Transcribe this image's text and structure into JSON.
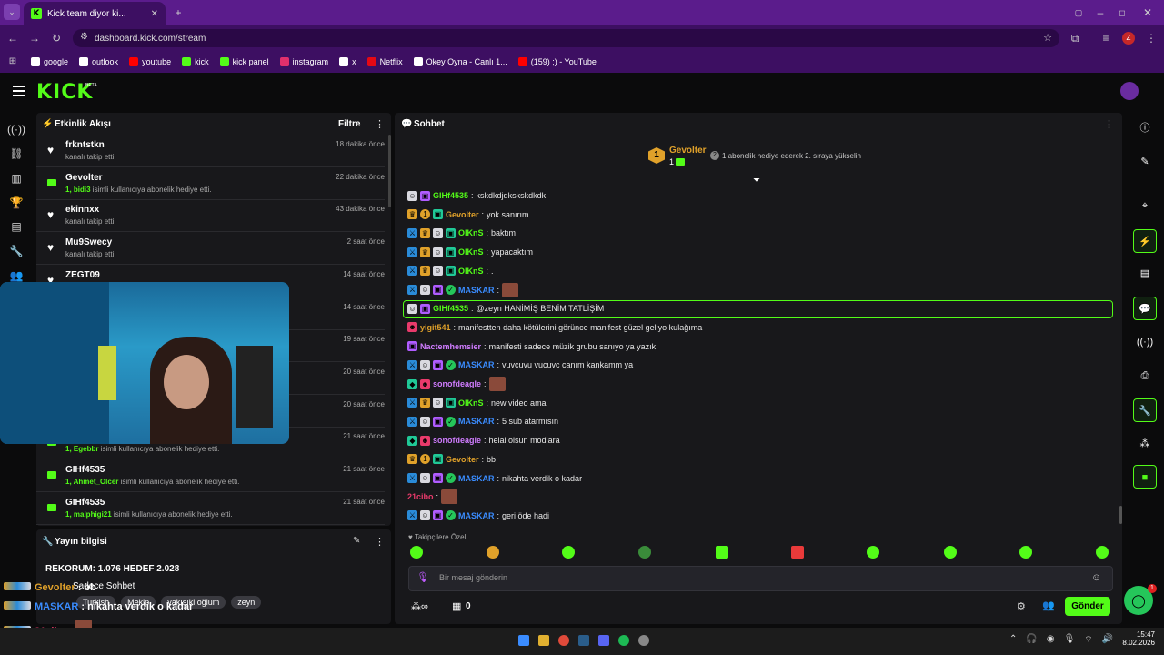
{
  "browser": {
    "tab_title": "Kick team diyor ki...",
    "url": "dashboard.kick.com/stream",
    "bookmarks": [
      {
        "label": "google",
        "color": "#ffffff"
      },
      {
        "label": "outlook",
        "color": "#ffffff"
      },
      {
        "label": "youtube",
        "color": "#ff0000"
      },
      {
        "label": "kick",
        "color": "#53fc18"
      },
      {
        "label": "kick panel",
        "color": "#53fc18"
      },
      {
        "label": "instagram",
        "color": "#e1306c"
      },
      {
        "label": "x",
        "color": "#ffffff"
      },
      {
        "label": "Netflix",
        "color": "#e50914"
      },
      {
        "label": "Okey Oyna - Canlı 1...",
        "color": "#ffffff"
      },
      {
        "label": "(159) ;) - YouTube",
        "color": "#ff0000"
      }
    ],
    "profile_initial": "Z"
  },
  "kick": {
    "logo": "KICK",
    "beta": "BETA",
    "accent": "#53fc18"
  },
  "activity": {
    "title": "Etkinlik Akışı",
    "filter": "Filtre",
    "items": [
      {
        "name": "frkntstkn",
        "sub_user": "",
        "sub": "kanalı takip etti",
        "time": "18 dakika önce",
        "icon": "heart"
      },
      {
        "name": "Gevolter",
        "sub_user": "1, bidi3",
        "sub": " isimli kullanıcıya abonelik hediye etti.",
        "time": "22 dakika önce",
        "icon": "gift"
      },
      {
        "name": "ekinnxx",
        "sub_user": "",
        "sub": "kanalı takip etti",
        "time": "43 dakika önce",
        "icon": "heart"
      },
      {
        "name": "Mu9Swecy",
        "sub_user": "",
        "sub": "kanalı takip etti",
        "time": "2 saat önce",
        "icon": "heart"
      },
      {
        "name": "ZEGT09",
        "sub_user": "",
        "sub": "",
        "time": "14 saat önce",
        "icon": "heart"
      },
      {
        "name": "",
        "sub_user": "",
        "sub": "",
        "time": "14 saat önce",
        "icon": "heart"
      },
      {
        "name": "",
        "sub_user": "",
        "sub": "",
        "time": "19 saat önce",
        "icon": "heart"
      },
      {
        "name": "",
        "sub_user": "",
        "sub": "",
        "time": "20 saat önce",
        "icon": "heart"
      },
      {
        "name": "",
        "sub_user": "",
        "sub": "",
        "time": "20 saat önce",
        "icon": "heart"
      },
      {
        "name": "GIHf4535",
        "sub_user": "1, Egebbr",
        "sub": " isimli kullanıcıya abonelik hediye etti.",
        "time": "21 saat önce",
        "icon": "gift"
      },
      {
        "name": "GIHf4535",
        "sub_user": "1, Ahmet_Olcer",
        "sub": " isimli kullanıcıya abonelik hediye etti.",
        "time": "21 saat önce",
        "icon": "gift"
      },
      {
        "name": "GIHf4535",
        "sub_user": "1, malphigi21",
        "sub": " isimli kullanıcıya abonelik hediye etti.",
        "time": "21 saat önce",
        "icon": "gift"
      }
    ]
  },
  "stream_info": {
    "title": "Yayın bilgisi",
    "record": "REKORUM: 1.076 HEDEF 2.028",
    "category": "Sadece Sohbet",
    "tags": [
      "Turkish",
      "Mekip",
      "yakışıklıoğlum",
      "zeyn"
    ]
  },
  "chat": {
    "title": "Sohbet",
    "pinned_user": "Gevolter",
    "pinned_count": "1",
    "pinned_rank": "1",
    "pinned_note": "1 abonelik hediye ederek 2. sıraya yükselin",
    "messages": [
      {
        "badges": [
          "sub",
          "gift"
        ],
        "user": "GIHf4535",
        "color": "#53fc18",
        "text": "kskdkdjdkskskdkdk"
      },
      {
        "badges": [
          "crown",
          "num",
          "gift2"
        ],
        "user": "Gevolter",
        "color": "#e0a12a",
        "text": "yok sanırım"
      },
      {
        "badges": [
          "mod",
          "crown",
          "sub",
          "gift2"
        ],
        "user": "OIKnS",
        "color": "#53fc18",
        "text": "baktım"
      },
      {
        "badges": [
          "mod",
          "crown",
          "sub",
          "gift2"
        ],
        "user": "OIKnS",
        "color": "#53fc18",
        "text": "yapacaktım"
      },
      {
        "badges": [
          "mod",
          "crown",
          "sub",
          "gift2"
        ],
        "user": "OIKnS",
        "color": "#53fc18",
        "text": "."
      },
      {
        "badges": [
          "mod",
          "sub",
          "gift",
          "verify"
        ],
        "user": "MASKAR",
        "color": "#3a8cff",
        "text": "",
        "emote": true
      },
      {
        "badges": [
          "sub",
          "gift"
        ],
        "user": "GIHf4535",
        "color": "#53fc18",
        "text": "@zeyn HANİMİŞ BENİM TATLİŞİM",
        "highlight": true
      },
      {
        "badges": [
          "og"
        ],
        "user": "yigit541",
        "color": "#e0a12a",
        "text": "manifestten daha kötülerini görünce manifest güzel geliyo kulağıma"
      },
      {
        "badges": [
          "gift"
        ],
        "user": "Nactemhemsier",
        "color": "#d07cff",
        "text": "manifesti sadece müzik grubu sanıyo ya yazık"
      },
      {
        "badges": [
          "mod",
          "sub",
          "gift",
          "verify"
        ],
        "user": "MASKAR",
        "color": "#3a8cff",
        "text": "vuvcuvu vucuvc canım kankamm ya"
      },
      {
        "badges": [
          "vip",
          "og"
        ],
        "user": "sonofdeagle",
        "color": "#d07cff",
        "text": "",
        "emote": true
      },
      {
        "badges": [
          "mod",
          "crown",
          "sub",
          "gift2"
        ],
        "user": "OIKnS",
        "color": "#53fc18",
        "text": "new video ama"
      },
      {
        "badges": [
          "mod",
          "sub",
          "gift",
          "verify"
        ],
        "user": "MASKAR",
        "color": "#3a8cff",
        "text": "5 sub atarmısın"
      },
      {
        "badges": [
          "vip",
          "og"
        ],
        "user": "sonofdeagle",
        "color": "#d07cff",
        "text": "helal olsun modlara"
      },
      {
        "badges": [
          "crown",
          "num",
          "gift2"
        ],
        "user": "Gevolter",
        "color": "#e0a12a",
        "text": "bb"
      },
      {
        "badges": [
          "mod",
          "sub",
          "gift",
          "verify"
        ],
        "user": "MASKAR",
        "color": "#3a8cff",
        "text": "nikahta verdik o kadar"
      },
      {
        "badges": [],
        "user": "21cibo",
        "color": "#e93a6b",
        "text": "",
        "emote": true
      },
      {
        "badges": [
          "mod",
          "sub",
          "gift",
          "verify"
        ],
        "user": "MASKAR",
        "color": "#3a8cff",
        "text": "geri öde hadi"
      }
    ],
    "follower_label": "Takipçilere Özel",
    "input_placeholder": "Bir mesaj gönderin",
    "points": "0",
    "send": "Gönder"
  },
  "overlay": {
    "lines": [
      {
        "user": "Gevolter",
        "color": "#e0a12a",
        "text": "bb"
      },
      {
        "user": "MASKAR",
        "color": "#3a8cff",
        "text": "nikahta verdik o kadar"
      },
      {
        "user": "21cibo",
        "color": "#e93a6b",
        "text": ""
      },
      {
        "user": "MASKAR",
        "color": "#3a8cff",
        "text": "geri öde hadi"
      }
    ]
  },
  "taskbar": {
    "time": "15:47",
    "date": "8.02.2026"
  },
  "notification_badge": "1"
}
